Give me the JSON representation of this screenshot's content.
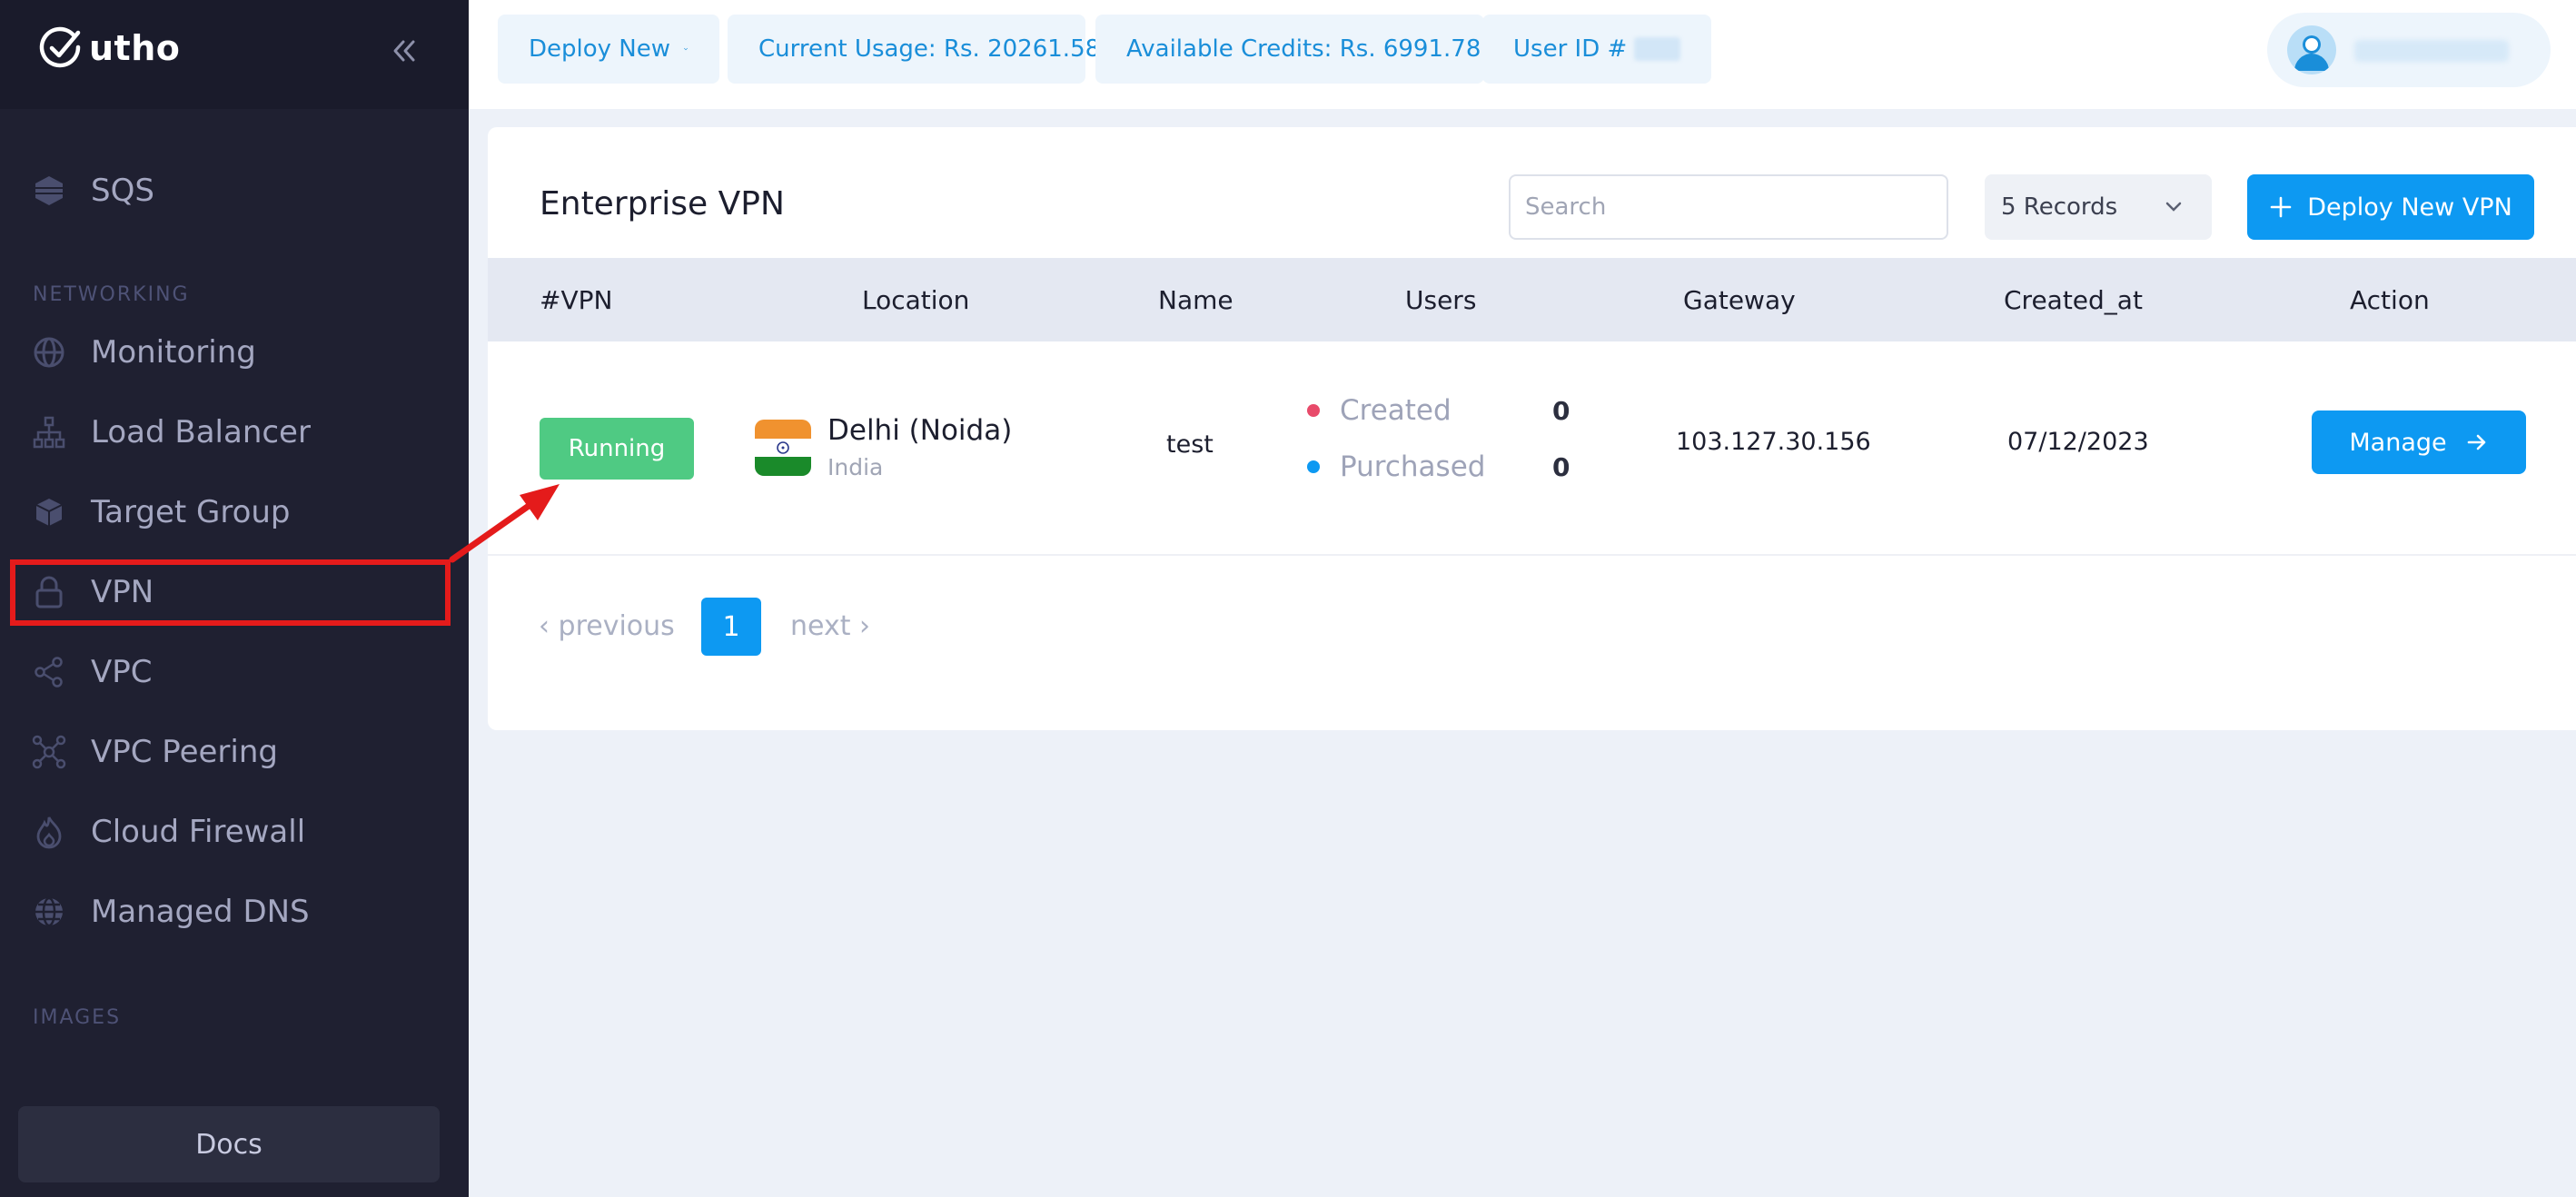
{
  "sidebar": {
    "brand": "utho",
    "items": [
      {
        "label": "SQS",
        "icon": "sqs-icon"
      },
      {
        "label": "Monitoring",
        "icon": "globe-icon"
      },
      {
        "label": "Load Balancer",
        "icon": "network-icon"
      },
      {
        "label": "Target Group",
        "icon": "cube-icon"
      },
      {
        "label": "VPN",
        "icon": "lock-icon"
      },
      {
        "label": "VPC",
        "icon": "share-icon"
      },
      {
        "label": "VPC Peering",
        "icon": "peering-icon"
      },
      {
        "label": "Cloud Firewall",
        "icon": "fire-icon"
      },
      {
        "label": "Managed DNS",
        "icon": "globe-icon"
      }
    ],
    "sections": {
      "networking": "NETWORKING",
      "images": "IMAGES"
    },
    "docs_label": "Docs"
  },
  "topbar": {
    "deploy_new": "Deploy New",
    "current_usage": "Current Usage: Rs. 20261.58",
    "available_credits": "Available Credits: Rs. 6991.78",
    "user_id": "User ID #"
  },
  "page": {
    "title": "Enterprise VPN",
    "search_placeholder": "Search",
    "records": "5 Records",
    "deploy_button": "Deploy New VPN"
  },
  "table": {
    "columns": [
      "#VPN",
      "Location",
      "Name",
      "Users",
      "Gateway",
      "Created_at",
      "Action"
    ],
    "rows": [
      {
        "status": "Running",
        "location": "Delhi (Noida)",
        "country": "India",
        "name": "test",
        "users_created_label": "Created",
        "users_created": "0",
        "users_purchased_label": "Purchased",
        "users_purchased": "0",
        "gateway": "103.127.30.156",
        "created_at": "07/12/2023",
        "action": "Manage"
      }
    ]
  },
  "pagination": {
    "previous": "‹ previous",
    "current": "1",
    "next": "next ›"
  },
  "colors": {
    "accent": "#0d99f2",
    "running": "#4fca83",
    "highlight": "#e41b1b",
    "created_dot": "#e84a6a",
    "purchased_dot": "#0d99f2"
  }
}
